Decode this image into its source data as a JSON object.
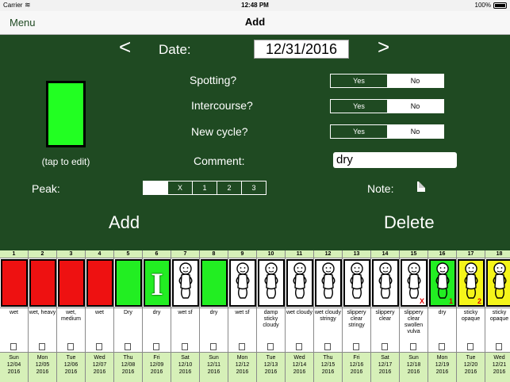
{
  "status_bar": {
    "carrier": "Carrier",
    "time": "12:48 PM",
    "battery": "100%"
  },
  "nav": {
    "menu": "Menu",
    "title": "Add"
  },
  "date": {
    "prev": "<",
    "next": ">",
    "label": "Date:",
    "value": "12/31/2016"
  },
  "color_box": {
    "color": "#22ff22",
    "caption": "(tap to edit)"
  },
  "spotting": {
    "label": "Spotting?",
    "yes": "Yes",
    "no": "No"
  },
  "intercourse": {
    "label": "Intercourse?",
    "yes": "Yes",
    "no": "No"
  },
  "new_cycle": {
    "label": "New cycle?",
    "yes": "Yes",
    "no": "No"
  },
  "comment": {
    "label": "Comment:",
    "value": "dry"
  },
  "peak": {
    "label": "Peak:",
    "options": [
      "",
      "X",
      "1",
      "2",
      "3"
    ]
  },
  "note": {
    "label": "Note:"
  },
  "actions": {
    "add": "Add",
    "delete": "Delete"
  },
  "chart": {
    "days": [
      {
        "n": "1",
        "stamp": "red",
        "desc": "wet",
        "dow": "Sun",
        "date": "12/04",
        "year": "2016"
      },
      {
        "n": "2",
        "stamp": "red",
        "desc": "wet, heavy",
        "dow": "Mon",
        "date": "12/05",
        "year": "2016"
      },
      {
        "n": "3",
        "stamp": "red",
        "desc": "wet, medium",
        "dow": "Tue",
        "date": "12/06",
        "year": "2016"
      },
      {
        "n": "4",
        "stamp": "red",
        "desc": "wet",
        "dow": "Wed",
        "date": "12/07",
        "year": "2016"
      },
      {
        "n": "5",
        "stamp": "green",
        "desc": "Dry",
        "dow": "Thu",
        "date": "12/08",
        "year": "2016"
      },
      {
        "n": "6",
        "stamp": "green-I",
        "desc": "dry",
        "dow": "Fri",
        "date": "12/09",
        "year": "2016"
      },
      {
        "n": "7",
        "stamp": "white-baby",
        "desc": "wet sf",
        "dow": "Sat",
        "date": "12/10",
        "year": "2016"
      },
      {
        "n": "8",
        "stamp": "green",
        "desc": "dry",
        "dow": "Sun",
        "date": "12/11",
        "year": "2016"
      },
      {
        "n": "9",
        "stamp": "white-baby",
        "desc": "wet sf",
        "dow": "Mon",
        "date": "12/12",
        "year": "2016"
      },
      {
        "n": "10",
        "stamp": "white-baby",
        "desc": "damp sticky cloudy",
        "dow": "Tue",
        "date": "12/13",
        "year": "2016"
      },
      {
        "n": "11",
        "stamp": "white-baby",
        "desc": "wet cloudy",
        "dow": "Wed",
        "date": "12/14",
        "year": "2016"
      },
      {
        "n": "12",
        "stamp": "white-baby",
        "desc": "wet cloudy stringy",
        "dow": "Thu",
        "date": "12/15",
        "year": "2016"
      },
      {
        "n": "13",
        "stamp": "white-baby",
        "desc": "slippery clear stringy",
        "dow": "Fri",
        "date": "12/16",
        "year": "2016"
      },
      {
        "n": "14",
        "stamp": "white-baby",
        "desc": "slippery clear",
        "dow": "Sat",
        "date": "12/17",
        "year": "2016"
      },
      {
        "n": "15",
        "stamp": "white-baby",
        "desc": "slippery clear swollen vulva",
        "mark": "X",
        "dow": "Sun",
        "date": "12/18",
        "year": "2016"
      },
      {
        "n": "16",
        "stamp": "green-baby",
        "desc": "dry",
        "mark": "1",
        "dow": "Mon",
        "date": "12/19",
        "year": "2016"
      },
      {
        "n": "17",
        "stamp": "yellow-baby",
        "desc": "sticky opaque",
        "mark": "2",
        "dow": "Tue",
        "date": "12/20",
        "year": "2016"
      },
      {
        "n": "18",
        "stamp": "yellow-baby",
        "desc": "sticky opaque",
        "dow": "Wed",
        "date": "12/21",
        "year": "2016"
      }
    ]
  },
  "colors": {
    "background": "#1f4a22",
    "red_stamp": "#ee1111",
    "green_stamp": "#22ee22",
    "yellow_stamp": "#f5f51a",
    "strip_header": "#d6f0b8"
  }
}
